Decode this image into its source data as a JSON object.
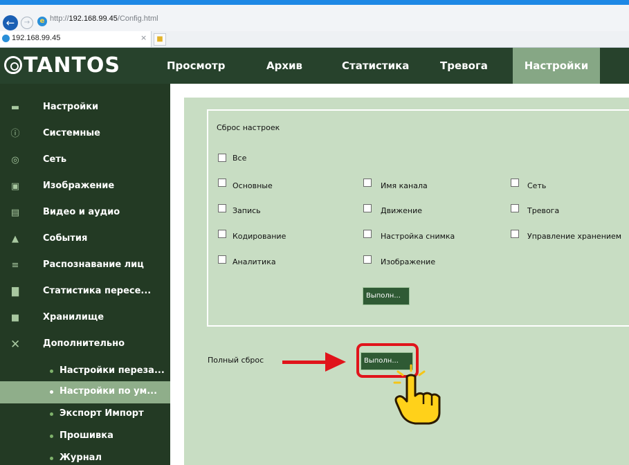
{
  "browser": {
    "url_prefix": "http://",
    "url_host": "192.168.99.45",
    "url_path": "/Config.html",
    "tab_title": "192.168.99.45",
    "tab_close": "×"
  },
  "app": {
    "logo_text": "TANTOS",
    "nav": [
      {
        "label": "Просмотр",
        "active": false
      },
      {
        "label": "Архив",
        "active": false
      },
      {
        "label": "Статистика",
        "active": false
      },
      {
        "label": "Тревога",
        "active": false
      },
      {
        "label": "Настройки",
        "active": true
      }
    ]
  },
  "sidebar": {
    "items": [
      {
        "label": "Настройки",
        "icon": "monitor-icon"
      },
      {
        "label": "Системные",
        "icon": "info-icon"
      },
      {
        "label": "Сеть",
        "icon": "globe-icon"
      },
      {
        "label": "Изображение",
        "icon": "image-icon"
      },
      {
        "label": "Видео и аудио",
        "icon": "video-icon"
      },
      {
        "label": "События",
        "icon": "bell-icon"
      },
      {
        "label": "Распознавание лиц",
        "icon": "face-icon"
      },
      {
        "label": "Статистика пересе...",
        "icon": "bar-chart-icon"
      },
      {
        "label": "Хранилище",
        "icon": "storage-icon"
      },
      {
        "label": "Дополнительно",
        "icon": "tools-icon"
      }
    ],
    "subitems": [
      {
        "label": "Настройки переза...",
        "active": false
      },
      {
        "label": "Настройки по ум...",
        "active": true
      },
      {
        "label": "Экспорт Импорт",
        "active": false
      },
      {
        "label": "Прошивка",
        "active": false
      },
      {
        "label": "Журнал",
        "active": false
      }
    ]
  },
  "reset_panel": {
    "title": "Сброс настроек",
    "all_label": "Все",
    "options": {
      "basic": "Основные",
      "channel_name": "Имя канала",
      "network": "Сеть",
      "record": "Запись",
      "motion": "Движение",
      "alarm": "Тревога",
      "encoding": "Кодирование",
      "snapshot": "Настройка снимка",
      "storage_mgmt": "Управление хранением",
      "analytics": "Аналитика",
      "image": "Изображение"
    },
    "execute_label": "Выполн..."
  },
  "full_reset": {
    "label": "Полный сброс",
    "execute_label": "Выполн..."
  },
  "colors": {
    "header_bg": "#27422c",
    "active_tab": "#86a785",
    "content_bg": "#c8ddc3",
    "button_bg": "#2f5a34",
    "highlight": "#e0141b"
  }
}
